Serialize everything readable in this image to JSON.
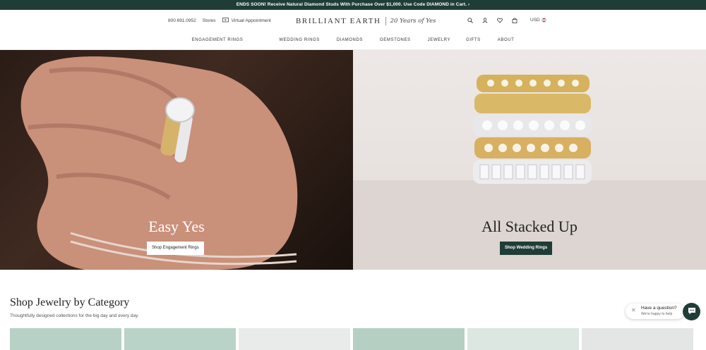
{
  "promo": {
    "prefix": "ENDS SOON! Receive Natural Diamond Studs With Purchase Over $1,000. Use Code ",
    "code": "DIAMOND",
    "suffix": " in Cart. ›"
  },
  "header": {
    "phone": "800.691.0952",
    "stores": "Stores",
    "virtual_appointment": "Virtual Appointment",
    "brand": "BRILLIANT EARTH",
    "tagline": "20 Years of Yes",
    "currency": "USD",
    "icons": [
      "search-icon",
      "account-icon",
      "heart-icon",
      "bag-icon",
      "flag-icon"
    ]
  },
  "nav": [
    "ENGAGEMENT RINGS",
    "WEDDING RINGS",
    "DIAMONDS",
    "GEMSTONES",
    "JEWELRY",
    "GIFTS",
    "ABOUT"
  ],
  "heroes": [
    {
      "title": "Easy Yes",
      "button": "Shop Engagement Rings"
    },
    {
      "title": "All Stacked Up",
      "button": "Shop Wedding Rings"
    }
  ],
  "category": {
    "title": "Shop Jewelry by Category",
    "subtitle": "Thoughtfully designed collections for the big day and every day."
  },
  "chat": {
    "question": "Have a question?",
    "help": "We're happy to help"
  },
  "colors": {
    "brand_green": "#1f3d36",
    "card_tints": [
      "#b7d1c6",
      "#b9d3c8",
      "#e8ebe9",
      "#b6cfc3",
      "#dde7e1",
      "#e4e6e5"
    ]
  }
}
